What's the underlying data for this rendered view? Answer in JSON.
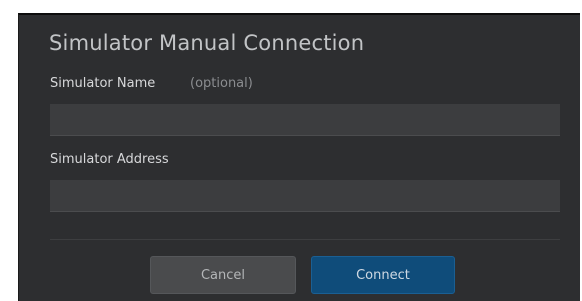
{
  "dialog": {
    "title": "Simulator Manual Connection",
    "name_label": "Simulator Name",
    "name_optional": "(optional)",
    "name_value": "",
    "address_label": "Simulator Address",
    "address_value": "",
    "cancel_label": "Cancel",
    "connect_label": "Connect"
  },
  "colors": {
    "background": "#2d2e30",
    "field": "#3c3d3f",
    "connect_button": "#0f4c7a",
    "cancel_button": "#4a4b4d"
  }
}
